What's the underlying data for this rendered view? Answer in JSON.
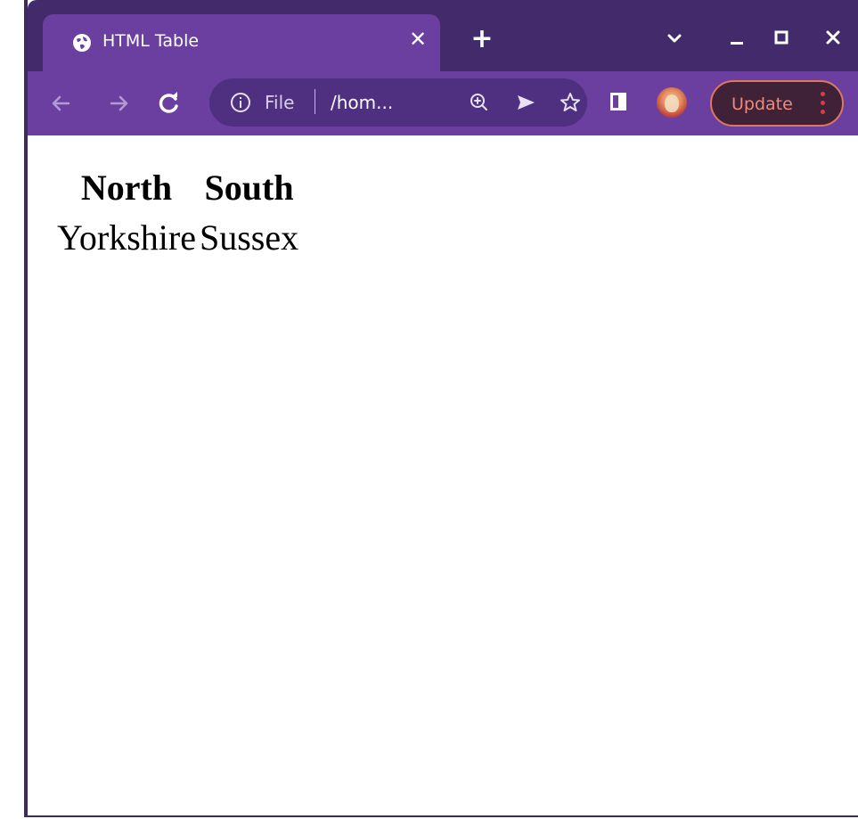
{
  "browser": {
    "tab": {
      "title": "HTML Table",
      "icon": "globe-icon",
      "close_icon": "close-icon"
    },
    "new_tab_icon": "plus-icon",
    "window_controls": [
      "chevron-down-icon",
      "minimize-icon",
      "maximize-icon",
      "close-icon"
    ],
    "toolbar": {
      "back_icon": "arrow-left-icon",
      "forward_icon": "arrow-right-icon",
      "reload_icon": "reload-icon",
      "omnibox": {
        "info_icon": "info-icon",
        "scheme_label": "File",
        "url_text": "/hom...",
        "zoom_icon": "zoom-in-icon",
        "send_icon": "send-icon",
        "bookmark_icon": "star-icon"
      },
      "side_panel_icon": "side-panel-icon",
      "profile_icon": "avatar",
      "update_label": "Update",
      "menu_icon": "kebab-menu-icon"
    },
    "colors": {
      "titlebar": "#432b6b",
      "toolbar": "#6a3fa0",
      "omnibox": "#4f2f80",
      "update_border": "#e0765e",
      "update_text": "#f08a78",
      "menu_dots": "#e03b3b"
    }
  },
  "page": {
    "table": {
      "headers": [
        "North",
        "South"
      ],
      "rows": [
        [
          "Yorkshire",
          "Sussex"
        ]
      ]
    }
  }
}
